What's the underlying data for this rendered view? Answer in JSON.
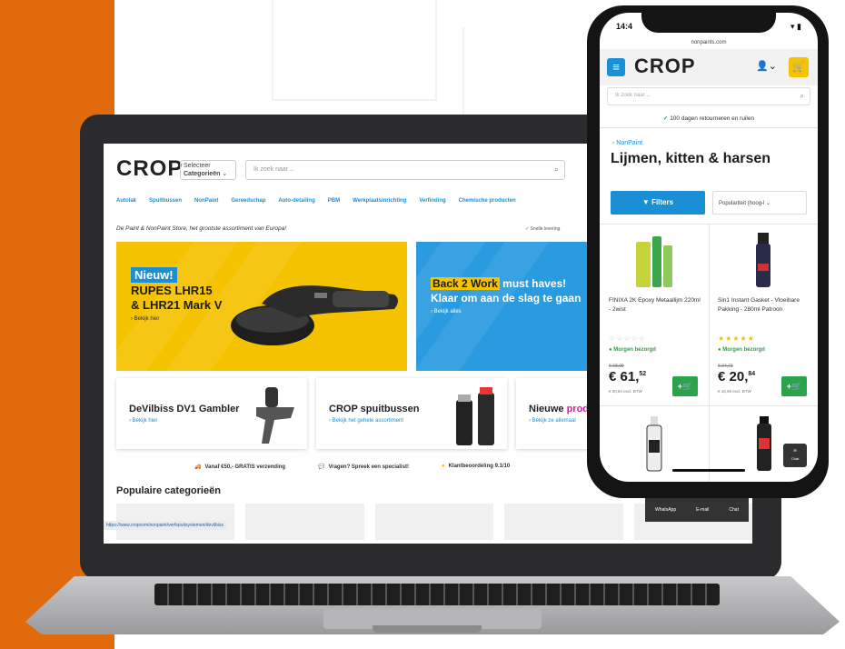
{
  "laptop_site": {
    "logo": "CROP",
    "category_select_small": "Selecteer",
    "category_select": "Categorieën",
    "search_placeholder": "Ik zoek naar ...",
    "nav": [
      "Autolak",
      "Spuitbussen",
      "NonPaint",
      "Gereedschap",
      "Auto-detailing",
      "PBM",
      "Werkplaatsinrichting",
      "Verfinding",
      "Chemische producten"
    ],
    "tagline": "De Paint & NonPaint Store, het grootste assortiment van Europa!",
    "usp_top": "✓ Snelle levering",
    "banner1": {
      "badge": "Nieuw!",
      "title1": "RUPES LHR15",
      "title2": "& LHR21 Mark V",
      "link": "› Bekijk hier",
      "color": "#f5c200"
    },
    "banner2": {
      "highlight": "Back 2 Work",
      "title1": " must haves!",
      "title2": "Klaar om aan de slag te gaan",
      "link": "› Bekijk alles",
      "color": "#2a9bdf"
    },
    "cards": [
      {
        "title": "DeVilbiss DV1 Gambler",
        "link": "› Bekijk hier"
      },
      {
        "title": "CROP spuitbussen",
        "link": "› Bekijk het gehele assortiment"
      },
      {
        "title_a": "Nieuwe ",
        "title_b": "prod",
        "link": "› Bekijk ze allemaal"
      }
    ],
    "usps": [
      "Vanaf €50,- GRATIS verzending",
      "Vragen? Spreek een specialist!",
      "Klantbeoordeling 9.1/10"
    ],
    "popular_heading": "Populaire categorieën",
    "status_url": "https://www.cropcom/nonpaint/verfspuitsystemen/devilbiss",
    "sticky": [
      "WhatsApp",
      "E-mail",
      "Chat"
    ]
  },
  "phone_site": {
    "time": "14:4",
    "url": "nonpaints.com",
    "logo": "CROP",
    "search_placeholder": "Ik zoek naar ...",
    "returns": "100 dagen retourneren en ruilen",
    "back_link": "‹ NonPaint",
    "page_title": "Lijmen, kitten & harsen",
    "filter_label": "Filters",
    "sort_label": "Populariteit (hoog-l",
    "products": [
      {
        "name": "FINIXA 2K Epoxy Metaallijm 220ml - 2wist",
        "stars": "☆☆☆☆☆",
        "stars_color": "#cccccc",
        "stock": "Morgen bezorgd",
        "old_price": "€ 68,09",
        "price_int": "€ 61,",
        "price_dec": "52",
        "excl": "€ 50,84 excl. BTW",
        "add": "+🛒"
      },
      {
        "name": "Sin1 Instant Gasket - Vloeibare Pakking - 280ml Patroon",
        "stars": "★★★★★",
        "stars_color": "#f5c200",
        "stock": "Morgen bezorgd",
        "old_price": "€ 24,73",
        "price_int": "€ 20,",
        "price_dec": "84",
        "excl": "€ 16,98 excl. BTW",
        "add": "+🛒"
      }
    ],
    "chat_label": "Chat"
  },
  "colors": {
    "accent": "#1a8fd6",
    "brand_orange": "#e06a0c",
    "yellow": "#f5c200",
    "green": "#2ba34a"
  }
}
